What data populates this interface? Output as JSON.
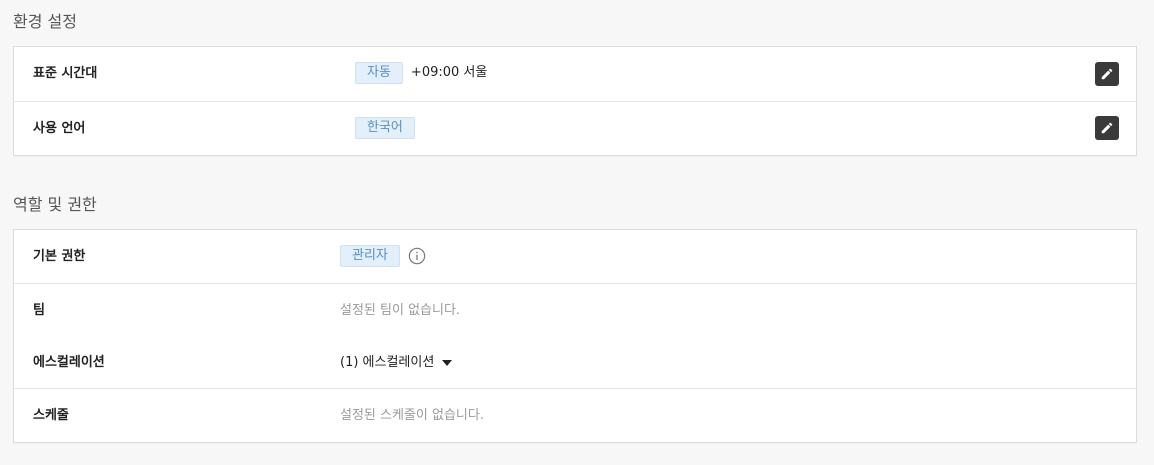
{
  "environment": {
    "title": "환경 설정",
    "timezone": {
      "label": "표준 시간대",
      "chip": "자동",
      "value": "+09:00 서울",
      "edit_icon": "pencil-icon"
    },
    "language": {
      "label": "사용 언어",
      "chip": "한국어",
      "edit_icon": "pencil-icon"
    }
  },
  "roles": {
    "title": "역할 및 권한",
    "default_permission": {
      "label": "기본 권한",
      "chip": "관리자",
      "info_icon": "info-icon"
    },
    "team": {
      "label": "팀",
      "value": "설정된 팀이 없습니다."
    },
    "escalation": {
      "label": "에스컬레이션",
      "value": "(1) 에스컬레이션",
      "caret_icon": "caret-down-icon"
    },
    "schedule": {
      "label": "스케줄",
      "value": "설정된 스케줄이 없습니다."
    }
  },
  "colors": {
    "chip_bg": "#e3f0fb",
    "chip_text": "#5a8fbf",
    "edit_button_bg": "#3a3a3a",
    "muted_text": "#9a9a9a"
  }
}
